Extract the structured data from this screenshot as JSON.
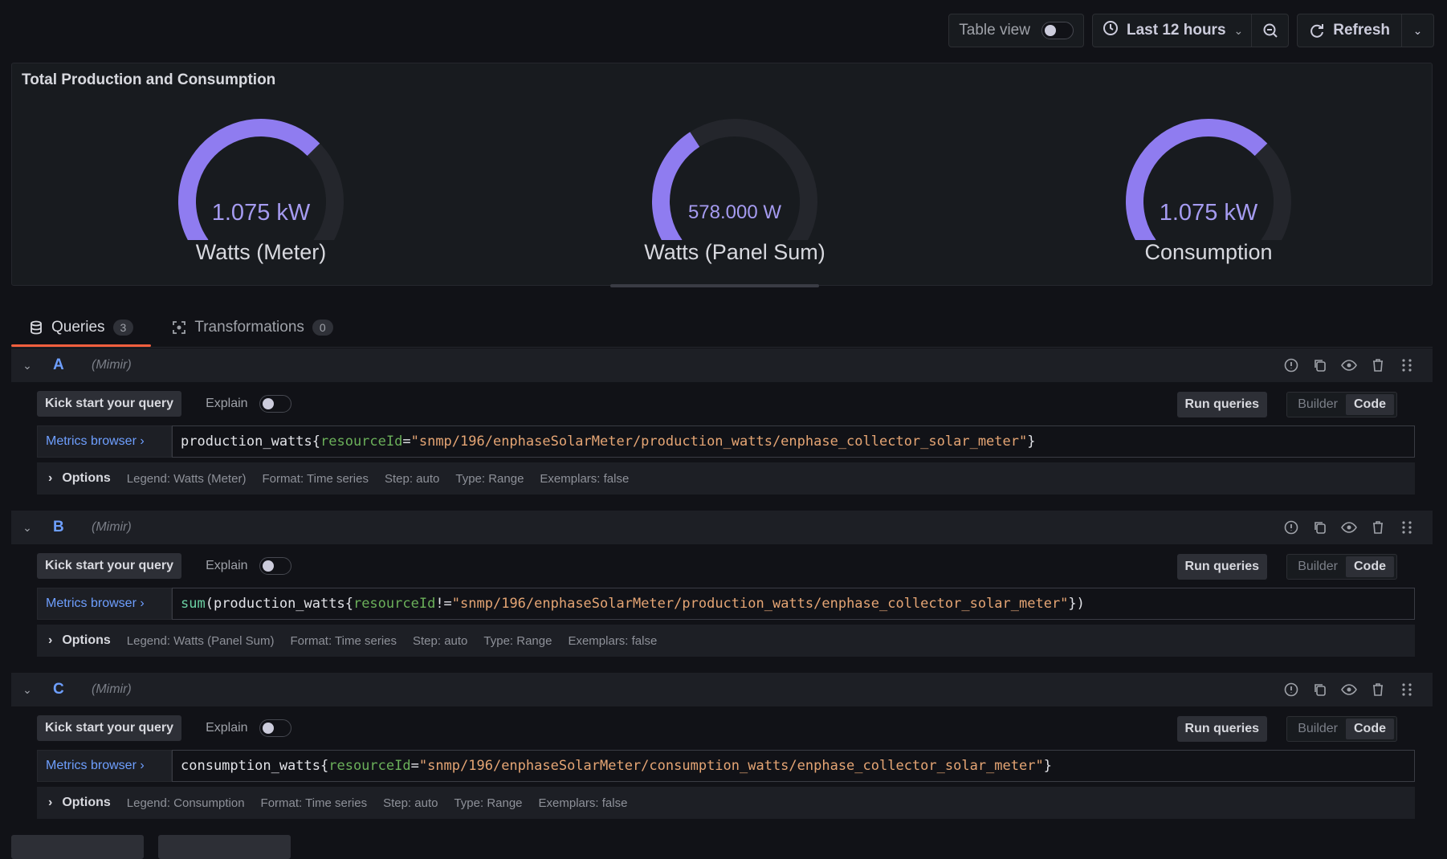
{
  "toolbar": {
    "table_view_label": "Table view",
    "time_range": "Last 12 hours",
    "refresh_label": "Refresh"
  },
  "panel": {
    "title": "Total Production and Consumption",
    "gauges": [
      {
        "value": "1.075 kW",
        "label": "Watts (Meter)",
        "fill": 0.68
      },
      {
        "value": "578.000 W",
        "label": "Watts (Panel Sum)",
        "fill": 0.37
      },
      {
        "value": "1.075 kW",
        "label": "Consumption",
        "fill": 0.68
      }
    ],
    "colors": {
      "gauge_fill": "#8f7cf0",
      "gauge_track": "#24262c",
      "value_text": "#a59bf0"
    }
  },
  "tabs": [
    {
      "label": "Queries",
      "count": "3"
    },
    {
      "label": "Transformations",
      "count": "0"
    }
  ],
  "queries": [
    {
      "id": "A",
      "datasource": "(Mimir)",
      "kick_start": "Kick start your query",
      "explain": "Explain",
      "run": "Run queries",
      "builder": "Builder",
      "code_tab": "Code",
      "metrics_browser": "Metrics browser ›",
      "code": {
        "fn_open": "",
        "metric": "production_watts{",
        "label": "resourceId",
        "op": "=",
        "value": "\"snmp/196/enphaseSolarMeter/production_watts/enphase_collector_solar_meter\"",
        "close": "}"
      },
      "options": "Options",
      "legend": "Legend: Watts (Meter)",
      "format": "Format: Time series",
      "step": "Step: auto",
      "type": "Type: Range",
      "exemplars": "Exemplars: false"
    },
    {
      "id": "B",
      "datasource": "(Mimir)",
      "kick_start": "Kick start your query",
      "explain": "Explain",
      "run": "Run queries",
      "builder": "Builder",
      "code_tab": "Code",
      "metrics_browser": "Metrics browser ›",
      "code": {
        "fn_open": "sum",
        "metric": "(production_watts{",
        "label": "resourceId",
        "op": "!=",
        "value": "\"snmp/196/enphaseSolarMeter/production_watts/enphase_collector_solar_meter\"",
        "close": "})"
      },
      "options": "Options",
      "legend": "Legend: Watts (Panel Sum)",
      "format": "Format: Time series",
      "step": "Step: auto",
      "type": "Type: Range",
      "exemplars": "Exemplars: false"
    },
    {
      "id": "C",
      "datasource": "(Mimir)",
      "kick_start": "Kick start your query",
      "explain": "Explain",
      "run": "Run queries",
      "builder": "Builder",
      "code_tab": "Code",
      "metrics_browser": "Metrics browser ›",
      "code": {
        "fn_open": "",
        "metric": "consumption_watts{",
        "label": "resourceId",
        "op": "=",
        "value": "\"snmp/196/enphaseSolarMeter/consumption_watts/enphase_collector_solar_meter\"",
        "close": "}"
      },
      "options": "Options",
      "legend": "Legend: Consumption",
      "format": "Format: Time series",
      "step": "Step: auto",
      "type": "Type: Range",
      "exemplars": "Exemplars: false"
    }
  ]
}
